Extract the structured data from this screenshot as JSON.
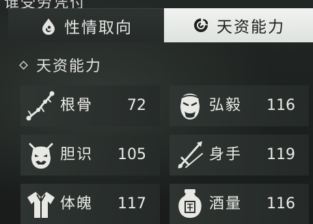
{
  "header": {
    "cut_title": "谁受劳凭付"
  },
  "tabs": [
    {
      "label": "性情取向",
      "icon": "water-drop-icon",
      "active": false
    },
    {
      "label": "天资能力",
      "icon": "swirl-cloud-icon",
      "active": true
    }
  ],
  "section": {
    "title": "天资能力"
  },
  "attributes": [
    {
      "label": "根骨",
      "value": "72",
      "icon": "bone-branch-icon"
    },
    {
      "label": "弘毅",
      "value": "116",
      "icon": "stern-face-icon"
    },
    {
      "label": "胆识",
      "value": "105",
      "icon": "demon-mask-icon"
    },
    {
      "label": "身手",
      "value": "119",
      "icon": "crossed-blades-icon"
    },
    {
      "label": "体魄",
      "value": "117",
      "icon": "robe-icon"
    },
    {
      "label": "酒量",
      "value": "116",
      "icon": "wine-jar-icon"
    }
  ],
  "colors": {
    "background": "#1b1f1d",
    "card": "#303633",
    "active_tab": "#eef0ed",
    "text": "#ecece8"
  }
}
